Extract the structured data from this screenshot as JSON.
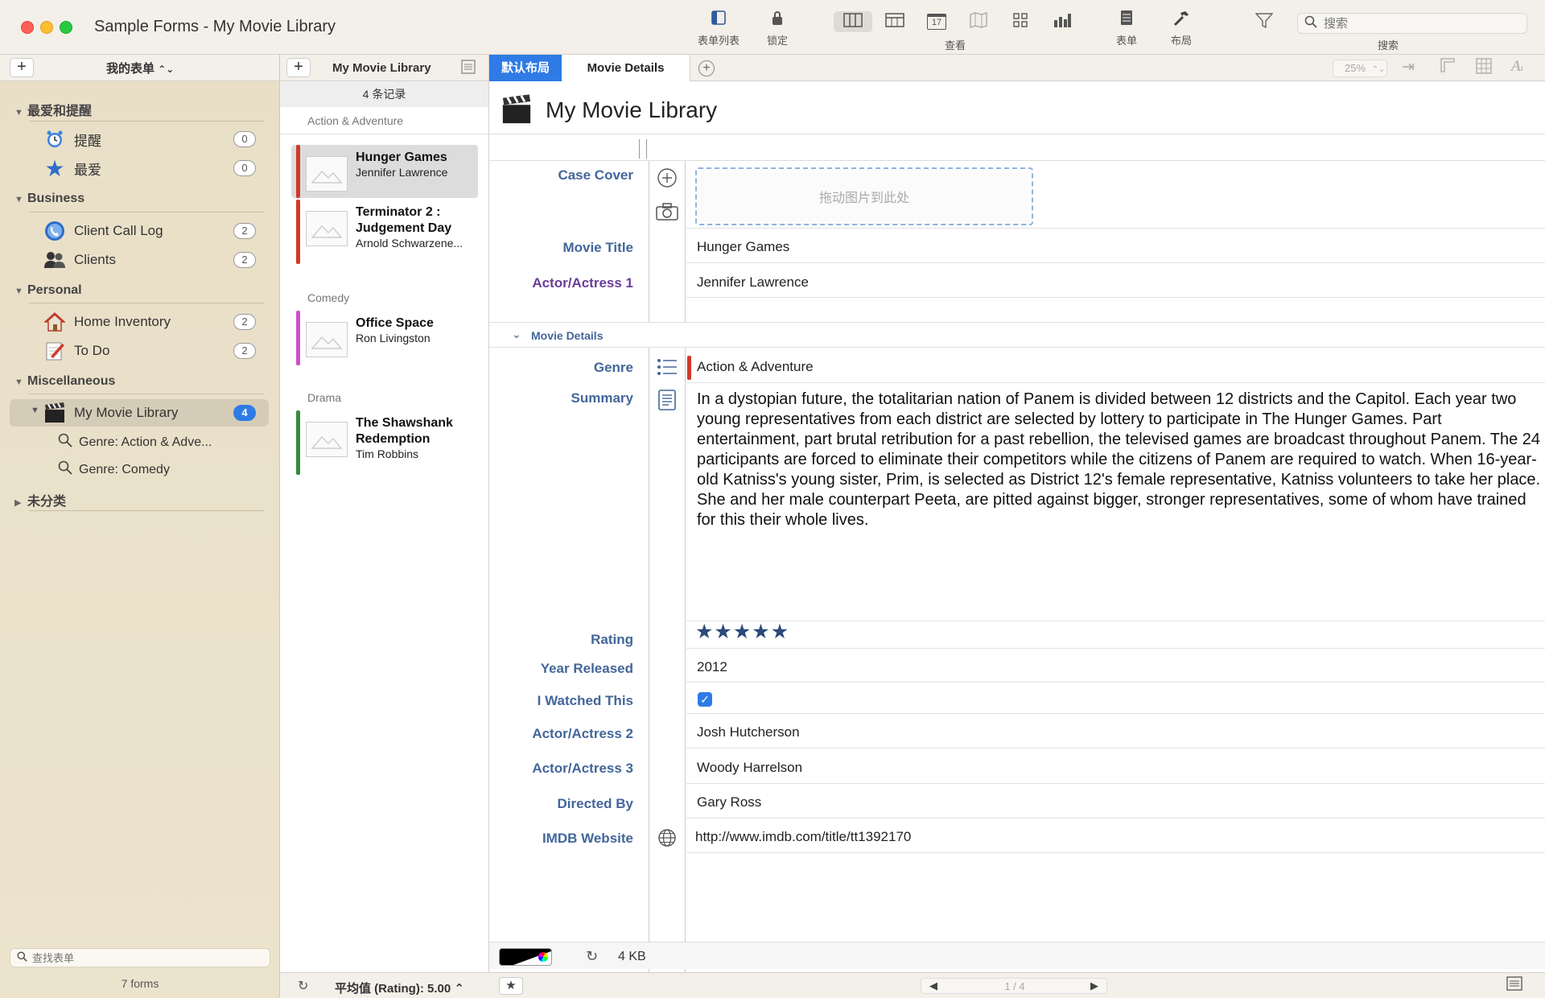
{
  "window": {
    "title": "Sample Forms - My Movie Library"
  },
  "toolbar": {
    "form_list_label": "表单列表",
    "lock_label": "锁定",
    "view_label": "查看",
    "form_label": "表单",
    "layout_label": "布局",
    "search_label": "搜索",
    "search_placeholder": "搜索",
    "calendar_day": "17"
  },
  "sidebar": {
    "title": "我的表单",
    "sections": [
      {
        "label": "最爱和提醒",
        "items": [
          {
            "label": "提醒",
            "count": "0"
          },
          {
            "label": "最爱",
            "count": "0"
          }
        ]
      },
      {
        "label": "Business",
        "items": [
          {
            "label": "Client Call Log",
            "count": "2"
          },
          {
            "label": "Clients",
            "count": "2"
          }
        ]
      },
      {
        "label": "Personal",
        "items": [
          {
            "label": "Home Inventory",
            "count": "2"
          },
          {
            "label": "To Do",
            "count": "2"
          }
        ]
      },
      {
        "label": "Miscellaneous",
        "items": [
          {
            "label": "My Movie Library",
            "count": "4"
          }
        ],
        "subitems": [
          {
            "label": "Genre: Action & Adve..."
          },
          {
            "label": "Genre: Comedy"
          }
        ]
      },
      {
        "label": "未分类"
      }
    ],
    "search_placeholder": "查找表单",
    "forms_count": "7 forms"
  },
  "records": {
    "title": "My Movie Library",
    "count": "4 条记录",
    "groups": [
      {
        "label": "Action & Adventure"
      },
      {
        "label": "Comedy"
      },
      {
        "label": "Drama"
      }
    ],
    "items": [
      {
        "title": "Hunger Games",
        "sub": "Jennifer Lawrence",
        "color": "#d0392b"
      },
      {
        "title": "Terminator 2 : Judgement Day",
        "sub": "Arnold Schwarzene...",
        "color": "#d0392b"
      },
      {
        "title": "Office Space",
        "sub": "Ron Livingston",
        "color": "#d050c8"
      },
      {
        "title": "The Shawshank Redemption",
        "sub": "Tim Robbins",
        "color": "#3a8a3a"
      }
    ],
    "footer_summary": "平均值 (Rating): 5.00 ⌃"
  },
  "tabs": {
    "default_layout": "默认布局",
    "movie_details": "Movie Details",
    "zoom": "25%"
  },
  "form": {
    "title": "My Movie Library",
    "case_cover_label": "Case Cover",
    "drop_hint": "拖动图片到此处",
    "movie_title_label": "Movie Title",
    "movie_title": "Hunger Games",
    "actor1_label": "Actor/Actress 1",
    "actor1": "Jennifer Lawrence",
    "section_label": "Movie Details",
    "genre_label": "Genre",
    "genre": "Action & Adventure",
    "genre_color": "#d0392b",
    "summary_label": "Summary",
    "summary": "In a dystopian future, the totalitarian nation of Panem is divided between 12 districts and the Capitol. Each year two young representatives from each district are selected by lottery to participate in The Hunger Games. Part entertainment, part brutal retribution for a past rebellion, the televised games are broadcast throughout Panem. The 24 participants are forced to eliminate their competitors while the citizens of Panem are required to watch. When 16-year-old Katniss's young sister, Prim, is selected as District 12's female representative, Katniss volunteers to take her place. She and her male counterpart Peeta, are pitted against bigger, stronger representatives, some of whom have trained for this their whole lives.",
    "rating_label": "Rating",
    "rating": 5,
    "rating_max": 5,
    "year_label": "Year Released",
    "year": "2012",
    "watched_label": "I Watched This",
    "watched": true,
    "actor2_label": "Actor/Actress 2",
    "actor2": "Josh Hutcherson",
    "actor3_label": "Actor/Actress 3",
    "actor3": "Woody Harrelson",
    "director_label": "Directed By",
    "director": "Gary Ross",
    "imdb_label": "IMDB Website",
    "imdb": "http://www.imdb.com/title/tt1392170"
  },
  "status": {
    "file_size": "4 KB",
    "pager": "1 / 4"
  }
}
